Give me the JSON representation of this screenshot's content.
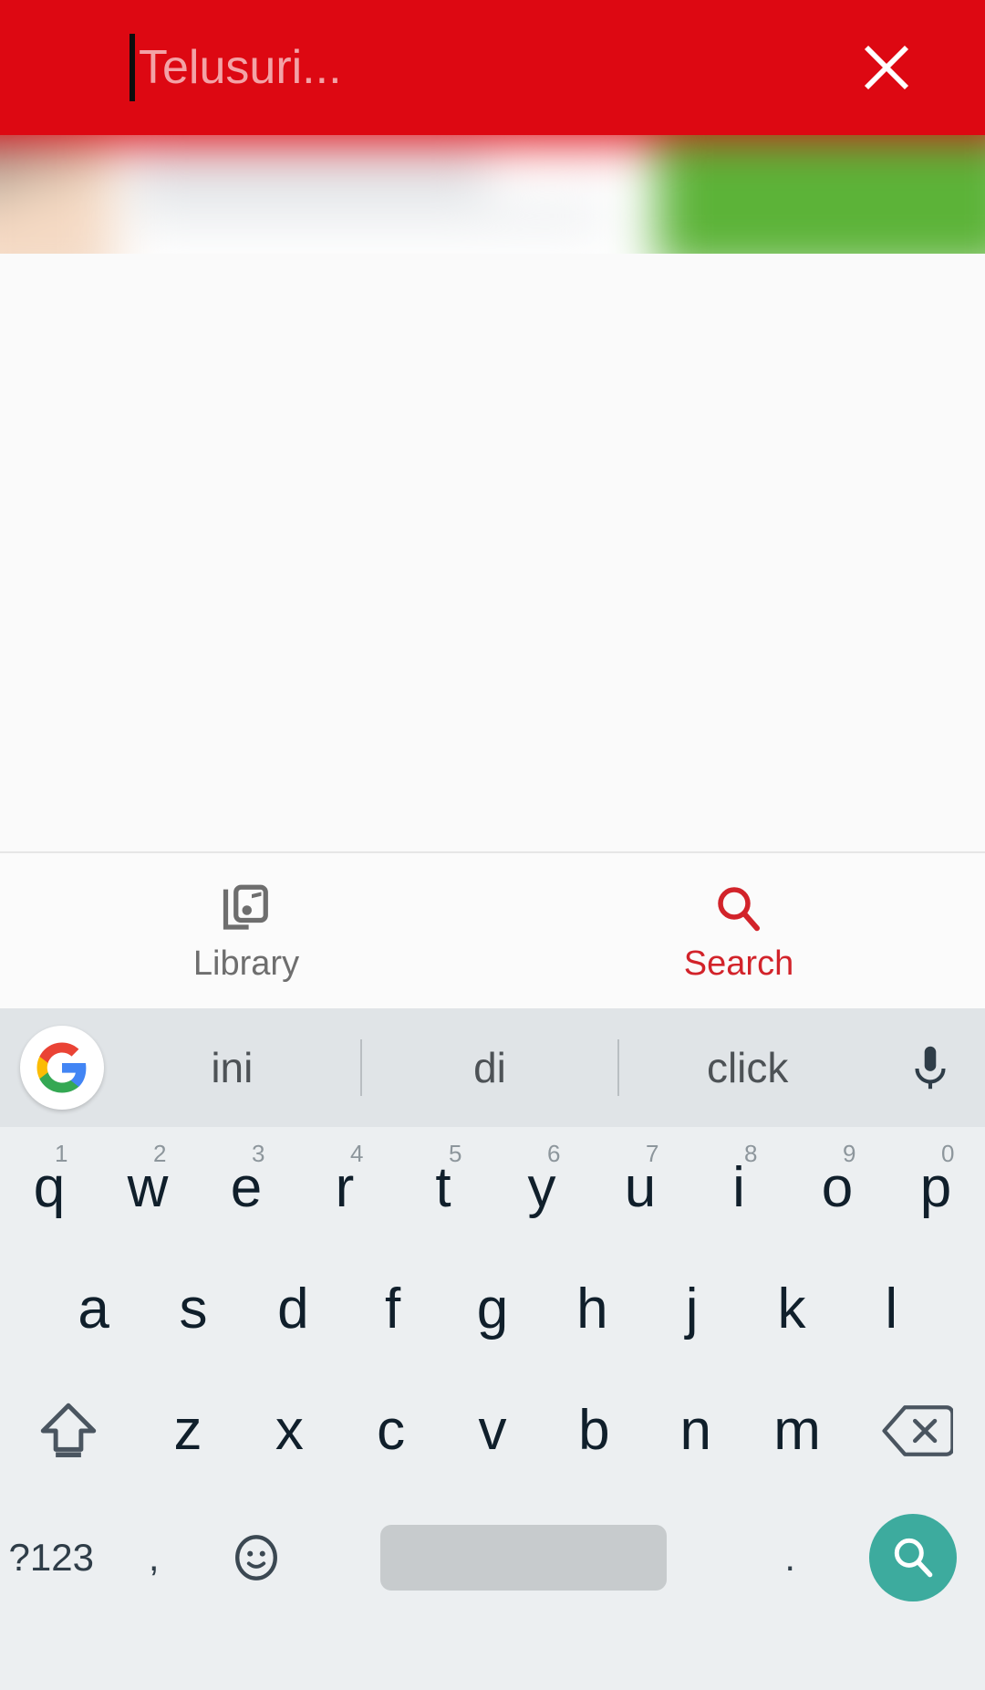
{
  "search_bar": {
    "placeholder": "Telusuri...",
    "value": "",
    "close_icon": "close-icon",
    "background_color": "#dd0812",
    "placeholder_color": "#f3a2a6"
  },
  "tabbar": {
    "tabs": [
      {
        "label": "Library",
        "icon": "music-library-icon",
        "active": false,
        "color": "#6e6e6e"
      },
      {
        "label": "Search",
        "icon": "search-icon",
        "active": true,
        "color": "#d2232a"
      }
    ]
  },
  "keyboard": {
    "suggestions": {
      "logo": "google-g-icon",
      "items": [
        "ini",
        "di",
        "click"
      ],
      "mic_icon": "microphone-icon"
    },
    "row1": [
      {
        "letter": "q",
        "num": "1"
      },
      {
        "letter": "w",
        "num": "2"
      },
      {
        "letter": "e",
        "num": "3"
      },
      {
        "letter": "r",
        "num": "4"
      },
      {
        "letter": "t",
        "num": "5"
      },
      {
        "letter": "y",
        "num": "6"
      },
      {
        "letter": "u",
        "num": "7"
      },
      {
        "letter": "i",
        "num": "8"
      },
      {
        "letter": "o",
        "num": "9"
      },
      {
        "letter": "p",
        "num": "0"
      }
    ],
    "row2": [
      "a",
      "s",
      "d",
      "f",
      "g",
      "h",
      "j",
      "k",
      "l"
    ],
    "row3": {
      "shift_icon": "shift-icon",
      "letters": [
        "z",
        "x",
        "c",
        "v",
        "b",
        "n",
        "m"
      ],
      "backspace_icon": "backspace-icon"
    },
    "row4": {
      "symbols_label": "?123",
      "comma": ",",
      "emoji_icon": "emoji-smiley-icon",
      "space": "",
      "period": ".",
      "enter_icon": "search-icon",
      "enter_color": "#3dab9e"
    },
    "background_color": "#eceff1",
    "key_text_color": "#101f2b"
  }
}
